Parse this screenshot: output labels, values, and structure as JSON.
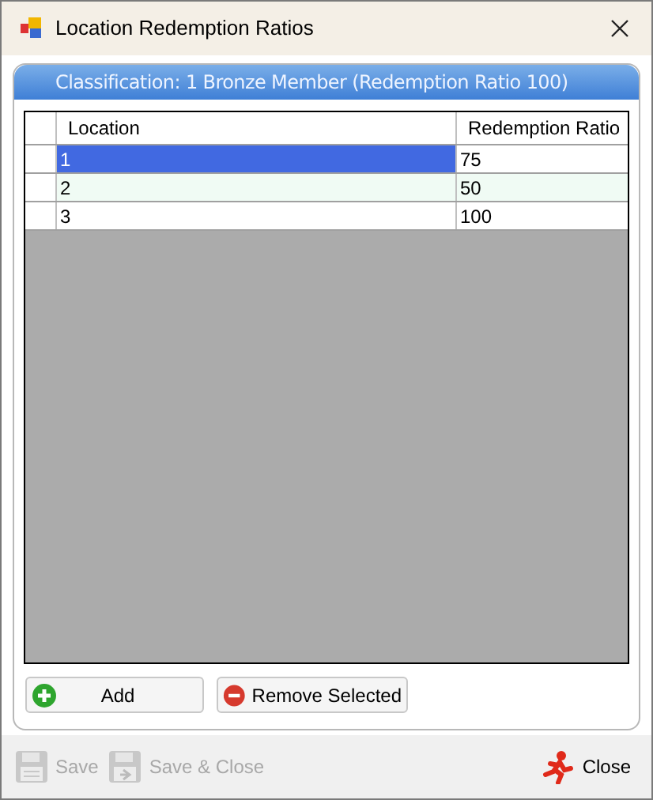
{
  "window": {
    "title": "Location Redemption Ratios"
  },
  "panel": {
    "title": "Classification: 1 Bronze Member (Redemption Ratio 100)"
  },
  "table": {
    "columns": [
      "Location",
      "Redemption Ratio"
    ],
    "rows": [
      {
        "cells": [
          "1",
          "75"
        ],
        "selected": true
      },
      {
        "cells": [
          "2",
          "50"
        ],
        "selected": false
      },
      {
        "cells": [
          "3",
          "100"
        ],
        "selected": false
      }
    ]
  },
  "grid_buttons": [
    {
      "label": "Add",
      "kind": "add"
    },
    {
      "label": "Remove Selected",
      "kind": "remove"
    }
  ],
  "footer_buttons": [
    {
      "label": "Save",
      "kind": "save",
      "disabled": true
    },
    {
      "label": "Save & Close",
      "kind": "save-close",
      "disabled": true
    },
    {
      "label": "Close",
      "kind": "close",
      "disabled": false
    }
  ]
}
